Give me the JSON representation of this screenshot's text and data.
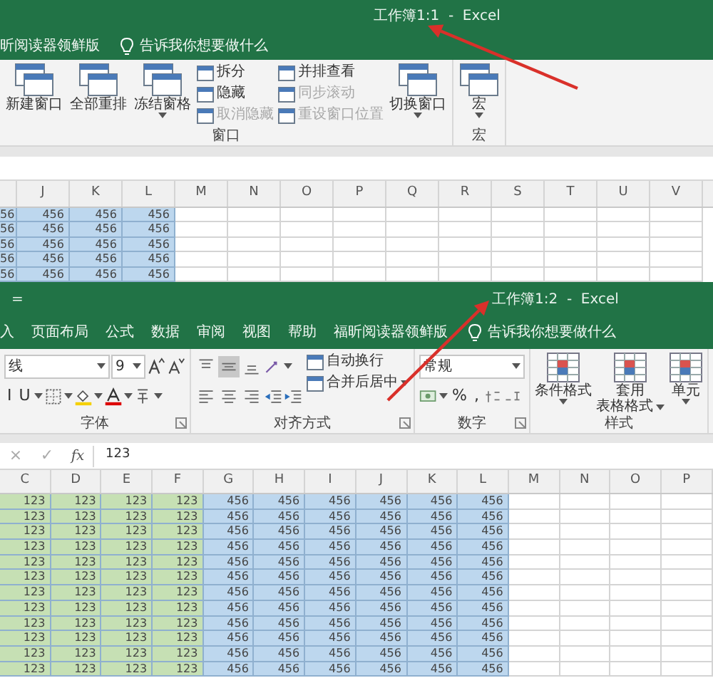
{
  "windows": [
    {
      "title": "工作簿1:1  -  Excel",
      "title_arrow": true,
      "tabs": [
        {
          "label": "昕阅读器领鲜版",
          "selected": false
        }
      ],
      "tell_me": "告诉我你想要做什么",
      "ribbon_groups": [
        {
          "label": "窗口",
          "columns": [
            [
              {
                "kind": "large",
                "label": "新建窗口"
              }
            ],
            [
              {
                "kind": "large",
                "label": "全部重排"
              }
            ],
            [
              {
                "kind": "large",
                "label": "冻结窗格",
                "dropdown": true
              }
            ],
            [
              {
                "kind": "small",
                "label": "拆分",
                "disabled": false
              },
              {
                "kind": "small",
                "label": "隐藏",
                "disabled": false
              },
              {
                "kind": "small",
                "label": "取消隐藏",
                "disabled": true
              }
            ],
            [
              {
                "kind": "small",
                "label": "并排查看",
                "disabled": false
              },
              {
                "kind": "small",
                "label": "同步滚动",
                "disabled": true
              },
              {
                "kind": "small",
                "label": "重设窗口位置",
                "disabled": true
              }
            ],
            [
              {
                "kind": "large",
                "label": "切换窗口",
                "dropdown": true
              }
            ]
          ]
        },
        {
          "label": "宏",
          "columns": [
            [
              {
                "kind": "large",
                "label": "宏",
                "dropdown": true
              }
            ]
          ]
        }
      ],
      "sheet": {
        "columns": [
          {
            "color": "#bdd7ee"
          },
          {
            "label": "J",
            "color": "#bdd7ee"
          },
          {
            "label": "K",
            "color": "#bdd7ee"
          },
          {
            "label": "L",
            "color": "#bdd7ee"
          },
          {
            "label": "M"
          },
          {
            "label": "N"
          },
          {
            "label": "O"
          },
          {
            "label": "P"
          },
          {
            "label": "Q"
          },
          {
            "label": "R"
          },
          {
            "label": "S"
          },
          {
            "label": "T"
          },
          {
            "label": "U"
          },
          {
            "label": "V"
          }
        ],
        "rows": [
          [
            "56",
            "456",
            "456",
            "456"
          ],
          [
            "56",
            "456",
            "456",
            "456"
          ],
          [
            "56",
            "456",
            "456",
            "456"
          ],
          [
            "56",
            "456",
            "456",
            "456"
          ],
          [
            "56",
            "456",
            "456",
            "456"
          ]
        ]
      }
    },
    {
      "title": "工作簿1:2  -  Excel",
      "title_arrow": true,
      "quick_access": "=",
      "tabs": [
        {
          "label": "入",
          "selected": false
        },
        {
          "label": "页面布局",
          "selected": false
        },
        {
          "label": "公式",
          "selected": false
        },
        {
          "label": "数据",
          "selected": false
        },
        {
          "label": "审阅",
          "selected": false
        },
        {
          "label": "视图",
          "selected": false
        },
        {
          "label": "帮助",
          "selected": false
        },
        {
          "label": "福昕阅读器领鲜版",
          "selected": false
        }
      ],
      "tell_me": "告诉我你想要做什么",
      "ribbon_groups": [
        {
          "label": "字体",
          "launcher": true,
          "columns": [
            [
              {
                "kind": "row",
                "items": [
                  {
                    "kind": "field",
                    "value": "线",
                    "dropdown": true
                  },
                  {
                    "kind": "field",
                    "value": "9",
                    "dropdown": true
                  },
                  {
                    "kind": "grow"
                  },
                  {
                    "kind": "shrink"
                  }
                ]
              },
              {
                "kind": "row",
                "items": [
                  {
                    "kind": "text",
                    "label": "I"
                  },
                  {
                    "kind": "text",
                    "label": "U"
                  },
                  {
                    "kind": "caret"
                  },
                  {
                    "kind": "borders"
                  },
                  {
                    "kind": "caret"
                  },
                  {
                    "kind": "fill"
                  },
                  {
                    "kind": "caret"
                  },
                  {
                    "kind": "fontcolor"
                  },
                  {
                    "kind": "caret"
                  },
                  {
                    "kind": "phonetic"
                  },
                  {
                    "kind": "caret"
                  }
                ]
              }
            ]
          ]
        },
        {
          "label": "对齐方式",
          "launcher": true,
          "columns": [
            [
              {
                "kind": "row",
                "items": [
                  {
                    "kind": "align-top",
                    "selected": false
                  },
                  {
                    "kind": "align-middle",
                    "selected": true
                  },
                  {
                    "kind": "align-bottom",
                    "selected": false
                  },
                  {
                    "kind": "orientation"
                  },
                  {
                    "kind": "caret"
                  }
                ]
              },
              {
                "kind": "row",
                "items": [
                  {
                    "kind": "align-left",
                    "selected": false
                  },
                  {
                    "kind": "align-center",
                    "selected": false
                  },
                  {
                    "kind": "align-right",
                    "selected": false
                  },
                  {
                    "kind": "indent-dec"
                  },
                  {
                    "kind": "indent-inc"
                  }
                ]
              }
            ],
            [
              {
                "kind": "small",
                "label": "自动换行",
                "disabled": false
              },
              {
                "kind": "small",
                "label": "合并后居中",
                "disabled": false,
                "dropdown": true
              }
            ]
          ]
        },
        {
          "label": "数字",
          "launcher": true,
          "columns": [
            [
              {
                "kind": "row",
                "items": [
                  {
                    "kind": "field",
                    "value": "常规",
                    "dropdown": true
                  }
                ]
              },
              {
                "kind": "row",
                "items": [
                  {
                    "kind": "currency"
                  },
                  {
                    "kind": "caret"
                  },
                  {
                    "kind": "text",
                    "label": "%"
                  },
                  {
                    "kind": "text",
                    "label": ","
                  },
                  {
                    "kind": "dec-inc"
                  },
                  {
                    "kind": "dec-dec"
                  }
                ]
              }
            ]
          ]
        },
        {
          "label": "样式",
          "columns": [
            [
              {
                "kind": "large",
                "label_lines": [
                  "条件格式"
                ],
                "dropdown": true
              }
            ],
            [
              {
                "kind": "large",
                "label_lines": [
                  "套用",
                  "表格格式"
                ],
                "dropdown": true
              }
            ],
            [
              {
                "kind": "large",
                "label_lines": [
                  "单元"
                ],
                "dropdown": true
              }
            ]
          ]
        }
      ],
      "formula_bar": {
        "cancel": "×",
        "enter": "✓",
        "function_label": "fx",
        "value": "123"
      },
      "sheet": {
        "columns": [
          {
            "label": "C",
            "color": "#c6e0b4"
          },
          {
            "label": "D",
            "color": "#c6e0b4"
          },
          {
            "label": "E",
            "color": "#c6e0b4"
          },
          {
            "label": "F",
            "color": "#c6e0b4"
          },
          {
            "label": "G",
            "color": "#bdd7ee"
          },
          {
            "label": "H",
            "color": "#bdd7ee"
          },
          {
            "label": "I",
            "color": "#bdd7ee"
          },
          {
            "label": "J",
            "color": "#bdd7ee"
          },
          {
            "label": "K",
            "color": "#bdd7ee"
          },
          {
            "label": "L",
            "color": "#bdd7ee"
          },
          {
            "label": "M"
          },
          {
            "label": "N"
          },
          {
            "label": "O"
          },
          {
            "label": "P"
          }
        ],
        "rows": [
          [
            "123",
            "123",
            "123",
            "123",
            "456",
            "456",
            "456",
            "456",
            "456",
            "456"
          ],
          [
            "123",
            "123",
            "123",
            "123",
            "456",
            "456",
            "456",
            "456",
            "456",
            "456"
          ],
          [
            "123",
            "123",
            "123",
            "123",
            "456",
            "456",
            "456",
            "456",
            "456",
            "456"
          ],
          [
            "123",
            "123",
            "123",
            "123",
            "456",
            "456",
            "456",
            "456",
            "456",
            "456"
          ],
          [
            "123",
            "123",
            "123",
            "123",
            "456",
            "456",
            "456",
            "456",
            "456",
            "456"
          ],
          [
            "123",
            "123",
            "123",
            "123",
            "456",
            "456",
            "456",
            "456",
            "456",
            "456"
          ],
          [
            "123",
            "123",
            "123",
            "123",
            "456",
            "456",
            "456",
            "456",
            "456",
            "456"
          ],
          [
            "123",
            "123",
            "123",
            "123",
            "456",
            "456",
            "456",
            "456",
            "456",
            "456"
          ],
          [
            "123",
            "123",
            "123",
            "123",
            "456",
            "456",
            "456",
            "456",
            "456",
            "456"
          ],
          [
            "123",
            "123",
            "123",
            "123",
            "456",
            "456",
            "456",
            "456",
            "456",
            "456"
          ],
          [
            "123",
            "123",
            "123",
            "123",
            "456",
            "456",
            "456",
            "456",
            "456",
            "456"
          ],
          [
            "123",
            "123",
            "123",
            "123",
            "456",
            "456",
            "456",
            "456",
            "456",
            "456"
          ]
        ]
      }
    }
  ]
}
